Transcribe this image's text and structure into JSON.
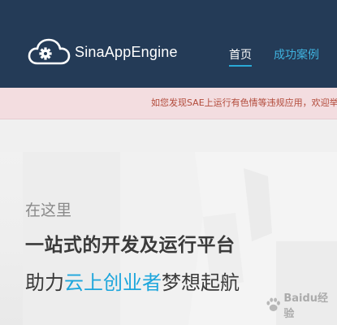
{
  "header": {
    "logo_text": "SinaAppEngine",
    "nav": {
      "home": "首页",
      "cases": "成功案例"
    }
  },
  "notice": {
    "text": "如您发现SAE上运行有色情等违规应用，欢迎举报"
  },
  "hero": {
    "subtitle": "在这里",
    "title": "一站式的开发及运行平台",
    "line_prefix": "助力",
    "line_highlight": "云上创业者",
    "line_suffix": "梦想起航"
  },
  "watermark": {
    "text": "Baidu经验"
  },
  "colors": {
    "header_bg": "#243b57",
    "nav_accent": "#2aa9d6",
    "notice_bg": "#f3dde0",
    "notice_text": "#b24a3a",
    "highlight": "#1ea6dc"
  },
  "icons": {
    "logo": "cloud-gear-icon",
    "watermark": "paw-icon"
  }
}
